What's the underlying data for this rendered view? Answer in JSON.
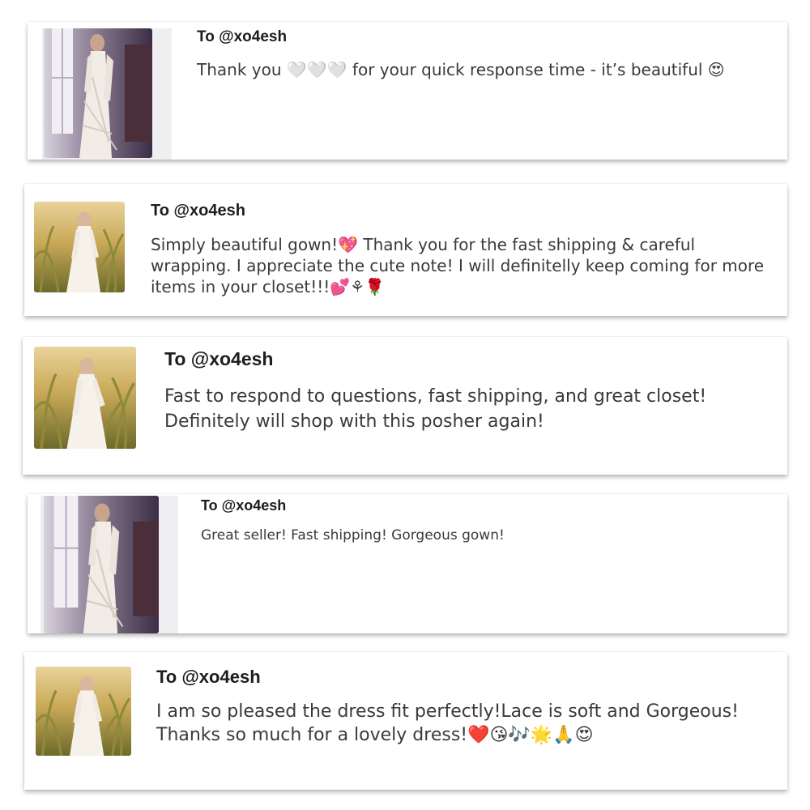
{
  "reviews": [
    {
      "recipient": "To @xo4esh",
      "message": "Thank you 🤍🤍🤍 for your quick response time - it’s beautiful 😍",
      "photo": "dress-window-photo"
    },
    {
      "recipient": "To @xo4esh",
      "message": "Simply beautiful gown!💖 Thank you for the fast shipping & careful wrapping. I appreciate the cute note! I will definitelly keep coming for more items in your closet!!!💕⚘🌹",
      "photo": "dress-field-photo"
    },
    {
      "recipient": "To @xo4esh",
      "message": "Fast to respond to questions, fast shipping, and great closet! Definitely will shop with this posher again!",
      "photo": "dress-field-photo"
    },
    {
      "recipient": "To @xo4esh",
      "message": "Great seller! Fast shipping! Gorgeous gown!",
      "photo": "dress-window-photo"
    },
    {
      "recipient": "To @xo4esh",
      "message": "I am so pleased the dress fit perfectly!Lace is soft and Gorgeous! Thanks so much for a lovely dress!❤️😘🎶🌟🙏😍",
      "photo": "dress-field-photo"
    }
  ],
  "colors": {
    "background": "#ffffff",
    "card": "#ffffff",
    "recipient_text": "#1d1d1d",
    "message_text": "#3a3a3a"
  }
}
